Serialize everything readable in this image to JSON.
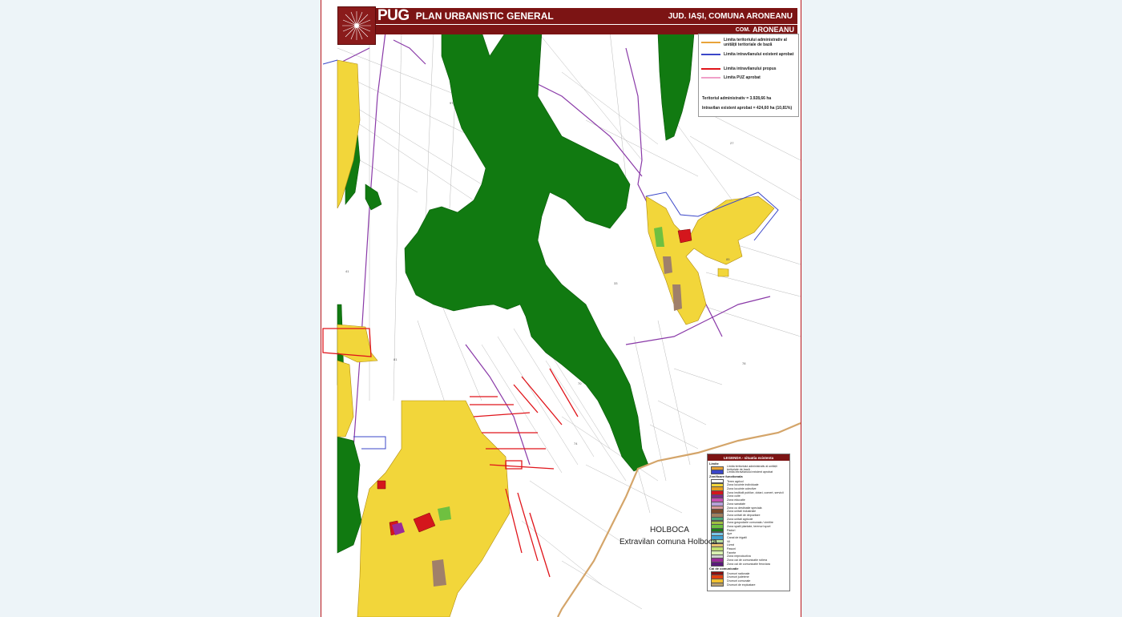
{
  "header": {
    "pug": "PUG",
    "plan_title": "PLAN URBANISTIC GENERAL",
    "county": "JUD. IAȘI, COMUNA ARONEANU",
    "com_prefix": "COM.",
    "com_name": "ARONEANU"
  },
  "legend_top": {
    "items": [
      {
        "label": "Limita teritoriului administrativ al unității teritoriale de bază",
        "color": "#e8a33a"
      },
      {
        "label": "Limita intravilanului existent aprobat",
        "color": "#3b47c9"
      },
      {
        "label": "Limita intravilanului propus",
        "color": "#e0151b"
      },
      {
        "label": "Limita PUZ aprobat",
        "color": "#f0a0c8"
      }
    ],
    "stat_total": "Teritoriul administrativ = 3.928,66 ha",
    "stat_intravilan": "Intravilan existent aprobat = 424,60 ha (10,81%)"
  },
  "legend_bottom": {
    "title": "LEGENDA - situatia existenta",
    "section_limits": "Limite",
    "limits": [
      {
        "label": "Limita teritoriului administrativ al unității teritoriale de bază",
        "color": "#e8a33a"
      },
      {
        "label": "Limita intravilanului existent aprobat",
        "color": "#3b47c9"
      }
    ],
    "section_zones": "Zonificare functionala",
    "zones": [
      {
        "label": "Teren agricol",
        "color": "#ffffff"
      },
      {
        "label": "Zona locuinte individuale",
        "color": "#f2d63a"
      },
      {
        "label": "Zona locuinte colective",
        "color": "#e5a020"
      },
      {
        "label": "Zona institutii publice, dotari, comert, servicii",
        "color": "#d4161c"
      },
      {
        "label": "Zona culte",
        "color": "#7d2a8a"
      },
      {
        "label": "Zona educatie",
        "color": "#c64fb0"
      },
      {
        "label": "Zona sanatate",
        "color": "#b6a0d8"
      },
      {
        "label": "Zona cu destinatie speciala",
        "color": "#d89a9a"
      },
      {
        "label": "Zona unitati industriale",
        "color": "#7b4a2a"
      },
      {
        "label": "Zona unitati de depozitare",
        "color": "#a08060"
      },
      {
        "label": "Zona unitati agricole",
        "color": "#4aa87a"
      },
      {
        "label": "Zona gospodarie comunala / cimitire",
        "color": "#a0c040"
      },
      {
        "label": "Zona spatii plantate, terenuri sport",
        "color": "#6fc040"
      },
      {
        "label": "Paduri",
        "color": "#1d7a1d"
      },
      {
        "label": "Ape",
        "color": "#7ac6e8"
      },
      {
        "label": "Canal de irigatii",
        "color": "#40a0d0"
      },
      {
        "label": "Vii",
        "color": "#b8e0a0"
      },
      {
        "label": "Livezi",
        "color": "#e8c070"
      },
      {
        "label": "Pasuni",
        "color": "#c0e070"
      },
      {
        "label": "Fanete",
        "color": "#d8f0b0"
      },
      {
        "label": "Zona neproductiva",
        "color": "#d0d0d0"
      },
      {
        "label": "Zona cai de comunicatie rutiera",
        "color": "#9a2a9a"
      },
      {
        "label": "Zona cai de comunicatie feroviara",
        "color": "#5a1a7a"
      }
    ],
    "section_roads": "Cai de comunicatie",
    "roads": [
      {
        "label": "Drumuri nationale",
        "color": "#8a1010"
      },
      {
        "label": "Drumuri judetene",
        "color": "#e04010"
      },
      {
        "label": "Drumuri comunale",
        "color": "#f0c030"
      },
      {
        "label": "Drumuri de exploatare",
        "color": "#b8a070"
      }
    ]
  },
  "map_labels": {
    "holboca": "HOLBOCA",
    "holboca_extravilan": "Extravilan comuna Holboca"
  },
  "colors": {
    "brand_red": "#7c1414",
    "forest": "#117a11",
    "residential": "#f2d63a",
    "boundary": "#d4a56a",
    "intravilan_existing": "#3b47c9",
    "intravilan_proposed": "#e0151b"
  }
}
